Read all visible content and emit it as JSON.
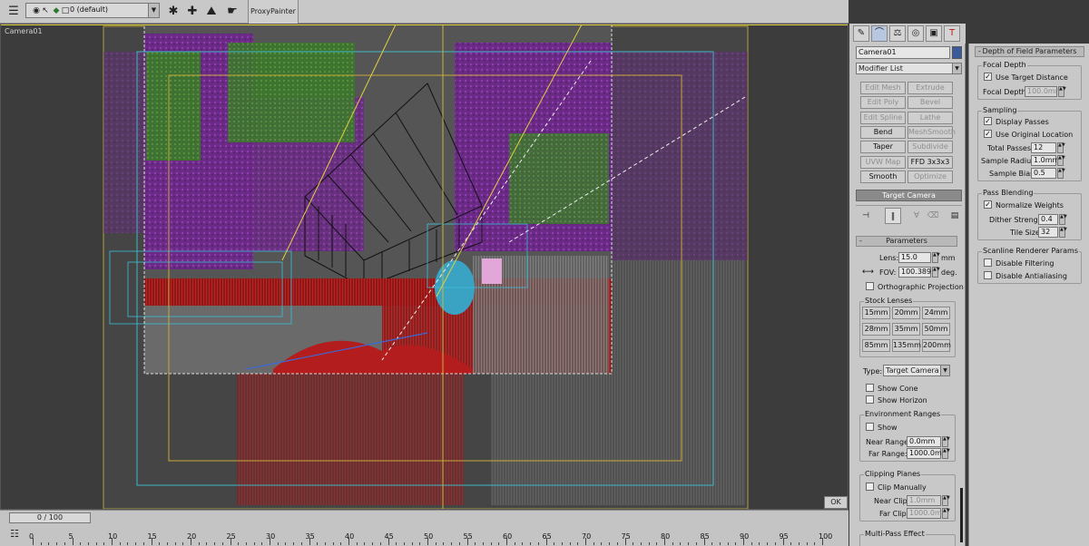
{
  "toolbar": {
    "layer_name": "0 (default)",
    "proxy_tab": "ProxyPainter"
  },
  "viewport": {
    "label": "Camera01",
    "ok_label": "OK"
  },
  "modify_panel": {
    "object_name": "Camera01",
    "object_color": "#3a5a9a",
    "modifier_list": "Modifier List",
    "buttons": [
      {
        "label": "Edit Mesh",
        "enabled": false
      },
      {
        "label": "Extrude",
        "enabled": false
      },
      {
        "label": "Edit Poly",
        "enabled": false
      },
      {
        "label": "Bevel",
        "enabled": false
      },
      {
        "label": "Edit Spline",
        "enabled": false
      },
      {
        "label": "Lathe",
        "enabled": false
      },
      {
        "label": "Bend",
        "enabled": true
      },
      {
        "label": "MeshSmooth",
        "enabled": false
      },
      {
        "label": "Taper",
        "enabled": true
      },
      {
        "label": "Subdivide",
        "enabled": false
      },
      {
        "label": "UVW Map",
        "enabled": false
      },
      {
        "label": "FFD 3x3x3",
        "enabled": true
      },
      {
        "label": "Smooth",
        "enabled": true
      },
      {
        "label": "Optimize",
        "enabled": false
      }
    ],
    "stack_item": "Target Camera",
    "parameters": {
      "title": "Parameters",
      "lens_label": "Lens:",
      "lens_value": "15.0",
      "lens_unit": "mm",
      "fov_label": "FOV:",
      "fov_value": "100.389",
      "fov_unit": "deg.",
      "ortho_label": "Orthographic Projection",
      "stock_lenses_title": "Stock Lenses",
      "stock_lenses": [
        "15mm",
        "20mm",
        "24mm",
        "28mm",
        "35mm",
        "50mm",
        "85mm",
        "135mm",
        "200mm"
      ],
      "type_label": "Type:",
      "type_value": "Target Camera",
      "show_cone": "Show Cone",
      "show_horizon": "Show Horizon",
      "env_title": "Environment Ranges",
      "env_show": "Show",
      "near_range_label": "Near Range:",
      "near_range_value": "0.0mm",
      "far_range_label": "Far Range:",
      "far_range_value": "1000.0mm",
      "clip_title": "Clipping Planes",
      "clip_manually": "Clip Manually",
      "near_clip_label": "Near Clip:",
      "near_clip_value": "1.0mm",
      "far_clip_label": "Far Clip:",
      "far_clip_value": "1000.0mm",
      "multipass_title": "Multi-Pass Effect"
    }
  },
  "dof_panel": {
    "title": "Depth of Field Parameters",
    "focal_title": "Focal Depth",
    "use_target_distance": "Use Target Distance",
    "focal_depth_label": "Focal Depth:",
    "focal_depth_value": "100.0mm",
    "sampling_title": "Sampling",
    "display_passes": "Display Passes",
    "use_original_location": "Use Original Location",
    "total_passes_label": "Total Passes:",
    "total_passes_value": "12",
    "sample_radius_label": "Sample Radius:",
    "sample_radius_value": "1.0mm",
    "sample_bias_label": "Sample Bias:",
    "sample_bias_value": "0.5",
    "pass_title": "Pass Blending",
    "normalize_weights": "Normalize Weights",
    "dither_label": "Dither Strength:",
    "dither_value": "0.4",
    "tile_label": "Tile Size:",
    "tile_value": "32",
    "scanline_title": "Scanline Renderer Params",
    "disable_filtering": "Disable Filtering",
    "disable_antialiasing": "Disable Antialiasing"
  },
  "timeline": {
    "slider_label": "0 / 100",
    "ticks": [
      "0",
      "5",
      "10",
      "15",
      "20",
      "25",
      "30",
      "35",
      "40",
      "45",
      "50",
      "55",
      "60",
      "65",
      "70",
      "75",
      "80",
      "85",
      "90",
      "95",
      "100"
    ]
  }
}
